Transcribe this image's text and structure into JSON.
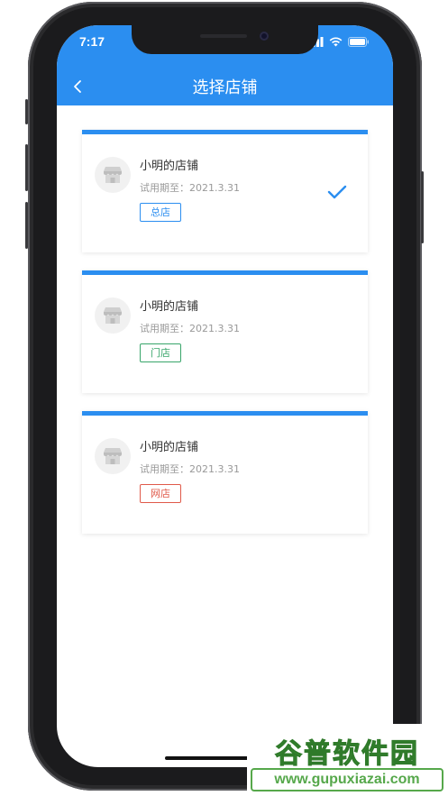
{
  "status_bar": {
    "time": "7:17"
  },
  "header": {
    "title": "选择店铺"
  },
  "shops": [
    {
      "name": "小明的店铺",
      "trial": "试用期至：2021.3.31",
      "tag": "总店",
      "tag_color": "#2b8ef0",
      "selected": true
    },
    {
      "name": "小明的店铺",
      "trial": "试用期至：2021.3.31",
      "tag": "门店",
      "tag_color": "#38a56a",
      "selected": false
    },
    {
      "name": "小明的店铺",
      "trial": "试用期至：2021.3.31",
      "tag": "网店",
      "tag_color": "#e05a4a",
      "selected": false
    }
  ],
  "colors": {
    "primary": "#2b8ef0"
  },
  "watermark": {
    "name": "谷普软件园",
    "url": "www.gupuxiazai.com"
  }
}
